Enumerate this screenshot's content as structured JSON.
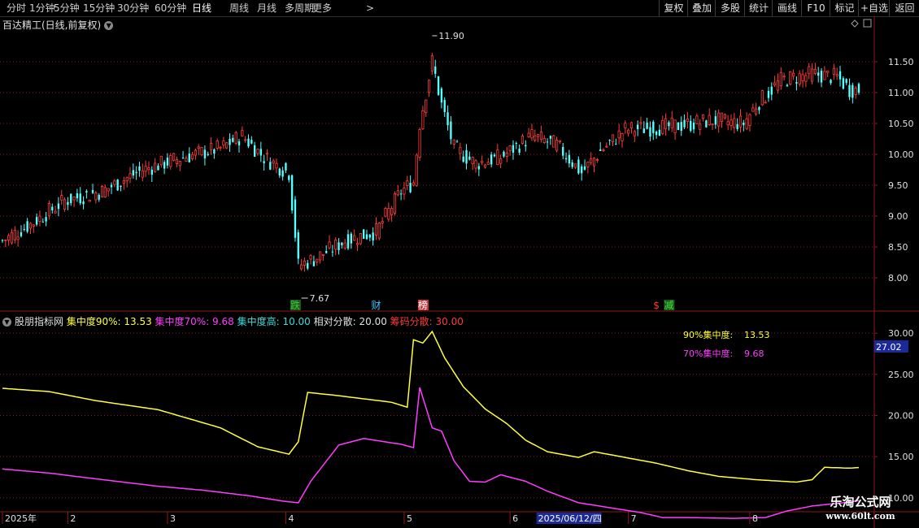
{
  "toolbar": {
    "left_items": [
      "分时",
      "1分钟",
      "5分钟",
      "15分钟",
      "30分钟",
      "60分钟",
      "日线",
      "周线",
      "月线",
      "多周期",
      "更多"
    ],
    "active": "日线",
    "right_items": [
      "复权",
      "叠加",
      "多股",
      "统计",
      "画线",
      "F10",
      "标记",
      "+自选",
      "返回"
    ]
  },
  "main_title": "百达精工(日线,前复权)",
  "indicator": {
    "name": "股朋指标网",
    "values": [
      {
        "label": "集中度90%: 13.53",
        "color": "#ffff3c"
      },
      {
        "label": "集中度70%: 9.68",
        "color": "#ff3cff"
      },
      {
        "label": "集中度高: 10.00",
        "color": "#3cdcdc"
      },
      {
        "label": "相对分散: 20.00",
        "color": "#e0e0e0"
      },
      {
        "label": "筹码分散: 30.00",
        "color": "#ff3c3c"
      }
    ],
    "legend": [
      {
        "label": "90%集中度:",
        "value": "13.53",
        "color": "#ffff3c"
      },
      {
        "label": "70%集中度:",
        "value": "9.68",
        "color": "#ff3cff"
      }
    ],
    "cursor_value": "27.02"
  },
  "price_axis": {
    "ticks": [
      "11.50",
      "11.00",
      "10.50",
      "10.00",
      "9.50",
      "9.00",
      "8.50",
      "8.00"
    ]
  },
  "indicator_axis": {
    "ticks": [
      "30.00",
      "25.00",
      "20.00",
      "15.00",
      "10.00"
    ]
  },
  "annotations": {
    "high": "11.90",
    "low": "7.67"
  },
  "markers": [
    {
      "text": "跌",
      "color": "#3cc83c",
      "bg": "#1e5a1e",
      "data_index": 94
    },
    {
      "text": "财",
      "color": "#3cc8ff",
      "bg": "#000000",
      "data_index": 120
    },
    {
      "text": "榜",
      "color": "#ffffff",
      "bg": "#c83c3c",
      "data_index": 135
    },
    {
      "text": "$",
      "color": "#ff3c3c",
      "bg": "#000000",
      "data_index": 210
    },
    {
      "text": "减",
      "color": "#3cdc3c",
      "bg": "#1e5a1e",
      "data_index": 214
    }
  ],
  "date_axis": {
    "labels": [
      {
        "text": "2025年",
        "idx": 0
      },
      {
        "text": "2",
        "idx": 21
      },
      {
        "text": "3",
        "idx": 53
      },
      {
        "text": "4",
        "idx": 91
      },
      {
        "text": "5",
        "idx": 129
      },
      {
        "text": "6",
        "idx": 163
      },
      {
        "text": "7",
        "idx": 201
      },
      {
        "text": "8",
        "idx": 240
      }
    ],
    "cursor_date": "2025/06/12/四"
  },
  "watermark": {
    "line1": "乐淘公式网",
    "line2": "www.60lt.com"
  },
  "colors": {
    "up": "#ff3c3c",
    "down": "#54ffff",
    "grid": "#8b1a1a"
  },
  "chart_data": [
    {
      "type": "candlestick",
      "title": "百达精工(日线,前复权)",
      "ylim": [
        7.5,
        12.0
      ],
      "count": 276,
      "price_path": [
        [
          0,
          8.6
        ],
        [
          10,
          8.9
        ],
        [
          20,
          9.25
        ],
        [
          32,
          9.4
        ],
        [
          45,
          9.75
        ],
        [
          58,
          9.95
        ],
        [
          70,
          10.1
        ],
        [
          77,
          10.3
        ],
        [
          84,
          9.95
        ],
        [
          92,
          9.7
        ],
        [
          95,
          8.2
        ],
        [
          100,
          8.3
        ],
        [
          110,
          8.6
        ],
        [
          120,
          8.75
        ],
        [
          128,
          9.4
        ],
        [
          132,
          9.55
        ],
        [
          134,
          10.5
        ],
        [
          138,
          11.5
        ],
        [
          141,
          10.8
        ],
        [
          145,
          10.1
        ],
        [
          152,
          9.85
        ],
        [
          160,
          9.95
        ],
        [
          170,
          10.3
        ],
        [
          178,
          10.15
        ],
        [
          186,
          9.7
        ],
        [
          192,
          10.05
        ],
        [
          200,
          10.4
        ],
        [
          215,
          10.45
        ],
        [
          228,
          10.55
        ],
        [
          238,
          10.5
        ],
        [
          242,
          10.8
        ],
        [
          250,
          11.2
        ],
        [
          260,
          11.3
        ],
        [
          268,
          11.25
        ],
        [
          272,
          11.05
        ]
      ]
    },
    {
      "type": "line",
      "title": "股朋指标网",
      "ylim": [
        8.5,
        31.0
      ],
      "series": [
        {
          "name": "集中度90%",
          "color": "#ffff3c",
          "points": [
            [
              0,
              23.3
            ],
            [
              15,
              22.9
            ],
            [
              30,
              21.8
            ],
            [
              50,
              20.7
            ],
            [
              70,
              18.5
            ],
            [
              82,
              16.2
            ],
            [
              92,
              15.3
            ],
            [
              95,
              16.8
            ],
            [
              98,
              22.8
            ],
            [
              108,
              22.4
            ],
            [
              125,
              21.6
            ],
            [
              130,
              21.0
            ],
            [
              132,
              29.2
            ],
            [
              135,
              28.8
            ],
            [
              138,
              30.2
            ],
            [
              142,
              27.0
            ],
            [
              148,
              23.5
            ],
            [
              155,
              20.8
            ],
            [
              162,
              19.0
            ],
            [
              168,
              17.0
            ],
            [
              175,
              15.6
            ],
            [
              185,
              14.9
            ],
            [
              190,
              15.6
            ],
            [
              200,
              14.9
            ],
            [
              210,
              14.2
            ],
            [
              220,
              13.3
            ],
            [
              230,
              12.6
            ],
            [
              242,
              12.2
            ],
            [
              255,
              11.9
            ],
            [
              260,
              12.2
            ],
            [
              264,
              13.7
            ],
            [
              272,
              13.6
            ],
            [
              280,
              13.8
            ],
            [
              290,
              13.53
            ]
          ]
        },
        {
          "name": "集中度70%",
          "color": "#ff3cff",
          "points": [
            [
              0,
              13.5
            ],
            [
              15,
              13.0
            ],
            [
              30,
              12.3
            ],
            [
              50,
              11.4
            ],
            [
              65,
              10.9
            ],
            [
              80,
              10.2
            ],
            [
              90,
              9.6
            ],
            [
              95,
              9.4
            ],
            [
              99,
              12.0
            ],
            [
              108,
              16.4
            ],
            [
              116,
              17.2
            ],
            [
              128,
              16.5
            ],
            [
              132,
              16.1
            ],
            [
              134,
              23.4
            ],
            [
              138,
              18.5
            ],
            [
              141,
              18.1
            ],
            [
              145,
              14.5
            ],
            [
              150,
              12.0
            ],
            [
              155,
              11.9
            ],
            [
              160,
              12.8
            ],
            [
              168,
              12.0
            ],
            [
              175,
              10.8
            ],
            [
              185,
              9.4
            ],
            [
              195,
              8.8
            ],
            [
              205,
              8.2
            ],
            [
              212,
              7.6
            ],
            [
              220,
              7.6
            ],
            [
              235,
              7.5
            ],
            [
              245,
              7.6
            ],
            [
              252,
              8.4
            ],
            [
              260,
              9.0
            ],
            [
              270,
              9.4
            ],
            [
              280,
              9.9
            ],
            [
              290,
              9.68
            ]
          ]
        }
      ]
    }
  ]
}
